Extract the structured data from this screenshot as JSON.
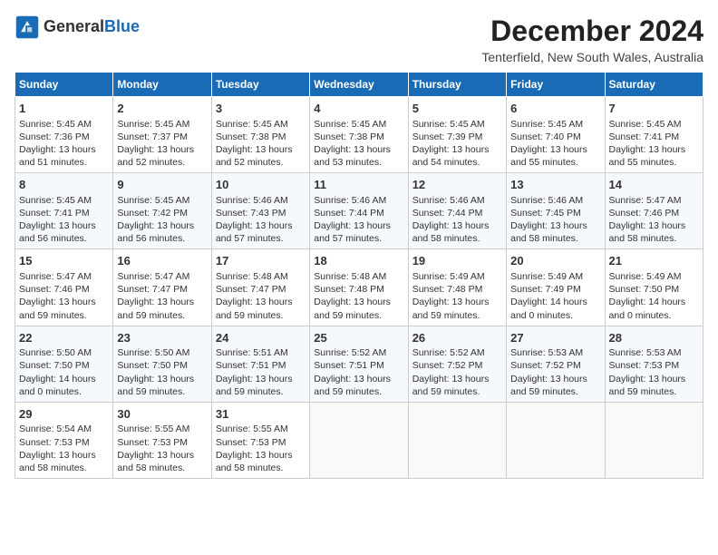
{
  "header": {
    "logo_general": "General",
    "logo_blue": "Blue",
    "main_title": "December 2024",
    "subtitle": "Tenterfield, New South Wales, Australia"
  },
  "calendar": {
    "columns": [
      "Sunday",
      "Monday",
      "Tuesday",
      "Wednesday",
      "Thursday",
      "Friday",
      "Saturday"
    ],
    "rows": [
      [
        {
          "day": "1",
          "lines": [
            "Sunrise: 5:45 AM",
            "Sunset: 7:36 PM",
            "Daylight: 13 hours",
            "and 51 minutes."
          ]
        },
        {
          "day": "2",
          "lines": [
            "Sunrise: 5:45 AM",
            "Sunset: 7:37 PM",
            "Daylight: 13 hours",
            "and 52 minutes."
          ]
        },
        {
          "day": "3",
          "lines": [
            "Sunrise: 5:45 AM",
            "Sunset: 7:38 PM",
            "Daylight: 13 hours",
            "and 52 minutes."
          ]
        },
        {
          "day": "4",
          "lines": [
            "Sunrise: 5:45 AM",
            "Sunset: 7:38 PM",
            "Daylight: 13 hours",
            "and 53 minutes."
          ]
        },
        {
          "day": "5",
          "lines": [
            "Sunrise: 5:45 AM",
            "Sunset: 7:39 PM",
            "Daylight: 13 hours",
            "and 54 minutes."
          ]
        },
        {
          "day": "6",
          "lines": [
            "Sunrise: 5:45 AM",
            "Sunset: 7:40 PM",
            "Daylight: 13 hours",
            "and 55 minutes."
          ]
        },
        {
          "day": "7",
          "lines": [
            "Sunrise: 5:45 AM",
            "Sunset: 7:41 PM",
            "Daylight: 13 hours",
            "and 55 minutes."
          ]
        }
      ],
      [
        {
          "day": "8",
          "lines": [
            "Sunrise: 5:45 AM",
            "Sunset: 7:41 PM",
            "Daylight: 13 hours",
            "and 56 minutes."
          ]
        },
        {
          "day": "9",
          "lines": [
            "Sunrise: 5:45 AM",
            "Sunset: 7:42 PM",
            "Daylight: 13 hours",
            "and 56 minutes."
          ]
        },
        {
          "day": "10",
          "lines": [
            "Sunrise: 5:46 AM",
            "Sunset: 7:43 PM",
            "Daylight: 13 hours",
            "and 57 minutes."
          ]
        },
        {
          "day": "11",
          "lines": [
            "Sunrise: 5:46 AM",
            "Sunset: 7:44 PM",
            "Daylight: 13 hours",
            "and 57 minutes."
          ]
        },
        {
          "day": "12",
          "lines": [
            "Sunrise: 5:46 AM",
            "Sunset: 7:44 PM",
            "Daylight: 13 hours",
            "and 58 minutes."
          ]
        },
        {
          "day": "13",
          "lines": [
            "Sunrise: 5:46 AM",
            "Sunset: 7:45 PM",
            "Daylight: 13 hours",
            "and 58 minutes."
          ]
        },
        {
          "day": "14",
          "lines": [
            "Sunrise: 5:47 AM",
            "Sunset: 7:46 PM",
            "Daylight: 13 hours",
            "and 58 minutes."
          ]
        }
      ],
      [
        {
          "day": "15",
          "lines": [
            "Sunrise: 5:47 AM",
            "Sunset: 7:46 PM",
            "Daylight: 13 hours",
            "and 59 minutes."
          ]
        },
        {
          "day": "16",
          "lines": [
            "Sunrise: 5:47 AM",
            "Sunset: 7:47 PM",
            "Daylight: 13 hours",
            "and 59 minutes."
          ]
        },
        {
          "day": "17",
          "lines": [
            "Sunrise: 5:48 AM",
            "Sunset: 7:47 PM",
            "Daylight: 13 hours",
            "and 59 minutes."
          ]
        },
        {
          "day": "18",
          "lines": [
            "Sunrise: 5:48 AM",
            "Sunset: 7:48 PM",
            "Daylight: 13 hours",
            "and 59 minutes."
          ]
        },
        {
          "day": "19",
          "lines": [
            "Sunrise: 5:49 AM",
            "Sunset: 7:48 PM",
            "Daylight: 13 hours",
            "and 59 minutes."
          ]
        },
        {
          "day": "20",
          "lines": [
            "Sunrise: 5:49 AM",
            "Sunset: 7:49 PM",
            "Daylight: 14 hours",
            "and 0 minutes."
          ]
        },
        {
          "day": "21",
          "lines": [
            "Sunrise: 5:49 AM",
            "Sunset: 7:50 PM",
            "Daylight: 14 hours",
            "and 0 minutes."
          ]
        }
      ],
      [
        {
          "day": "22",
          "lines": [
            "Sunrise: 5:50 AM",
            "Sunset: 7:50 PM",
            "Daylight: 14 hours",
            "and 0 minutes."
          ]
        },
        {
          "day": "23",
          "lines": [
            "Sunrise: 5:50 AM",
            "Sunset: 7:50 PM",
            "Daylight: 13 hours",
            "and 59 minutes."
          ]
        },
        {
          "day": "24",
          "lines": [
            "Sunrise: 5:51 AM",
            "Sunset: 7:51 PM",
            "Daylight: 13 hours",
            "and 59 minutes."
          ]
        },
        {
          "day": "25",
          "lines": [
            "Sunrise: 5:52 AM",
            "Sunset: 7:51 PM",
            "Daylight: 13 hours",
            "and 59 minutes."
          ]
        },
        {
          "day": "26",
          "lines": [
            "Sunrise: 5:52 AM",
            "Sunset: 7:52 PM",
            "Daylight: 13 hours",
            "and 59 minutes."
          ]
        },
        {
          "day": "27",
          "lines": [
            "Sunrise: 5:53 AM",
            "Sunset: 7:52 PM",
            "Daylight: 13 hours",
            "and 59 minutes."
          ]
        },
        {
          "day": "28",
          "lines": [
            "Sunrise: 5:53 AM",
            "Sunset: 7:53 PM",
            "Daylight: 13 hours",
            "and 59 minutes."
          ]
        }
      ],
      [
        {
          "day": "29",
          "lines": [
            "Sunrise: 5:54 AM",
            "Sunset: 7:53 PM",
            "Daylight: 13 hours",
            "and 58 minutes."
          ]
        },
        {
          "day": "30",
          "lines": [
            "Sunrise: 5:55 AM",
            "Sunset: 7:53 PM",
            "Daylight: 13 hours",
            "and 58 minutes."
          ]
        },
        {
          "day": "31",
          "lines": [
            "Sunrise: 5:55 AM",
            "Sunset: 7:53 PM",
            "Daylight: 13 hours",
            "and 58 minutes."
          ]
        },
        null,
        null,
        null,
        null
      ]
    ]
  }
}
